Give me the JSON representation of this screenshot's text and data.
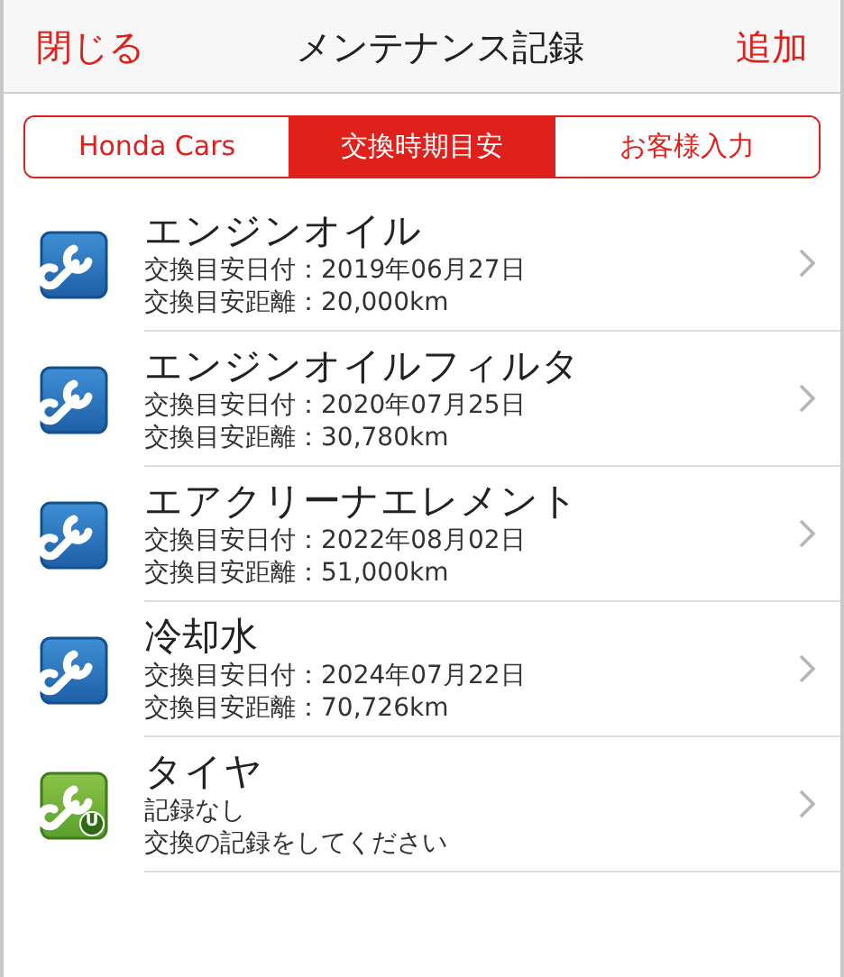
{
  "nav": {
    "left": "閉じる",
    "title": "メンテナンス記録",
    "right": "追加"
  },
  "segments": [
    {
      "label": "Honda Cars",
      "selected": false
    },
    {
      "label": "交換時期目安",
      "selected": true
    },
    {
      "label": "お客様入力",
      "selected": false
    }
  ],
  "items": [
    {
      "kind": "scheduled",
      "title": "エンジンオイル",
      "line_1": "交換目安日付：2019年06月27日",
      "line_2": "交換目安距離：20,000km"
    },
    {
      "kind": "scheduled",
      "title": "エンジンオイルフィルタ",
      "line_1": "交換目安日付：2020年07月25日",
      "line_2": "交換目安距離：30,780km"
    },
    {
      "kind": "scheduled",
      "title": "エアクリーナエレメント",
      "line_1": "交換目安日付：2022年08月02日",
      "line_2": "交換目安距離：51,000km"
    },
    {
      "kind": "scheduled",
      "title": "冷却水",
      "line_1": "交換目安日付：2024年07月22日",
      "line_2": "交換目安距離：70,726km"
    },
    {
      "kind": "user",
      "badge": "U",
      "title": "タイヤ",
      "line_1": "記録なし",
      "line_2": "交換の記録をしてください"
    }
  ]
}
